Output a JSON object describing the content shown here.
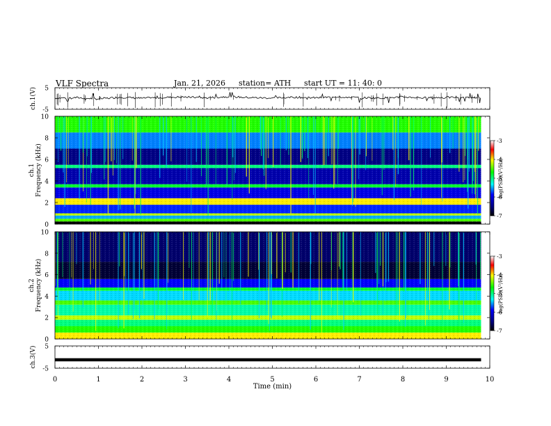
{
  "header": {
    "title": "VLF  Spectra",
    "date": "Jan. 21, 2026",
    "station": "station= ATH",
    "start": "start  UT  =   11: 40: 0"
  },
  "colors": {
    "spectrogram_low": "#000080",
    "spectrogram_mid": "#00ff00",
    "spectrogram_high": "#ff0000",
    "trace": "#000000"
  },
  "chart_data": [
    {
      "type": "line",
      "name": "ch1-waveform",
      "ylabel": "ch.1(V)",
      "ylim": [
        -5,
        5
      ],
      "yticks": [
        "5",
        "-5"
      ],
      "x": [
        0,
        0.5,
        1,
        1.5,
        2,
        2.5,
        3,
        3.5,
        4,
        4.5,
        5,
        5.5,
        6,
        6.5,
        7,
        7.5,
        8,
        8.5,
        9,
        9.5,
        9.8
      ],
      "y": [
        0.2,
        0.4,
        -0.2,
        0.6,
        0.1,
        0.5,
        0.7,
        0.3,
        0.9,
        0.4,
        0.2,
        0.6,
        0.3,
        0.8,
        0.4,
        0.2,
        0.7,
        0.3,
        0.5,
        0.6,
        0.3
      ]
    },
    {
      "type": "heatmap",
      "name": "ch1-spectrogram",
      "ylabel": "ch.1 Frequency  (kHz)",
      "ylim": [
        0,
        10
      ],
      "yticks": [
        "0",
        "2",
        "4",
        "6",
        "8",
        "10"
      ],
      "xlim": [
        0,
        10
      ],
      "data_extent_min": 9.8,
      "colorbar_label": "log(PSD)(V²/Hz)",
      "colorbar_ticks": [
        "-3",
        "-4",
        "-5",
        "-6",
        "-7"
      ],
      "bands_khz": [
        {
          "from": 0.0,
          "to": 0.25,
          "level": -7.0
        },
        {
          "from": 0.25,
          "to": 0.5,
          "level": -4.5
        },
        {
          "from": 0.5,
          "to": 0.8,
          "level": -5.5
        },
        {
          "from": 0.8,
          "to": 1.0,
          "level": -4.2
        },
        {
          "from": 1.0,
          "to": 1.8,
          "level": -5.8
        },
        {
          "from": 1.8,
          "to": 2.4,
          "level": -4.0
        },
        {
          "from": 2.4,
          "to": 3.4,
          "level": -6.0
        },
        {
          "from": 3.4,
          "to": 3.7,
          "level": -4.8
        },
        {
          "from": 3.7,
          "to": 5.2,
          "level": -6.3
        },
        {
          "from": 5.2,
          "to": 5.5,
          "level": -5.0
        },
        {
          "from": 5.5,
          "to": 7.0,
          "level": -6.5
        },
        {
          "from": 7.0,
          "to": 8.5,
          "level": -5.6
        },
        {
          "from": 8.5,
          "to": 10.0,
          "level": -4.6
        }
      ]
    },
    {
      "type": "heatmap",
      "name": "ch2-spectrogram",
      "ylabel": "ch.2 Frequency  (kHz)",
      "ylim": [
        0,
        10
      ],
      "yticks": [
        "0",
        "2",
        "4",
        "6",
        "8",
        "10"
      ],
      "xlim": [
        0,
        10
      ],
      "data_extent_min": 9.8,
      "colorbar_label": "log(PSD)(V²/Hz)",
      "colorbar_ticks": [
        "-3",
        "-4",
        "-5",
        "-6",
        "-7"
      ],
      "bands_khz": [
        {
          "from": 0.0,
          "to": 0.6,
          "level": -4.0
        },
        {
          "from": 0.6,
          "to": 1.2,
          "level": -4.6
        },
        {
          "from": 1.2,
          "to": 1.8,
          "level": -5.0
        },
        {
          "from": 1.8,
          "to": 2.2,
          "level": -4.2
        },
        {
          "from": 2.2,
          "to": 3.2,
          "level": -5.1
        },
        {
          "from": 3.2,
          "to": 3.6,
          "level": -4.5
        },
        {
          "from": 3.6,
          "to": 4.5,
          "level": -5.4
        },
        {
          "from": 4.5,
          "to": 4.8,
          "level": -4.8
        },
        {
          "from": 4.8,
          "to": 5.6,
          "level": -5.9
        },
        {
          "from": 5.6,
          "to": 7.2,
          "level": -6.8
        },
        {
          "from": 7.2,
          "to": 10.0,
          "level": -6.6
        }
      ]
    },
    {
      "type": "line",
      "name": "ch3-waveform",
      "ylabel": "ch.3(V)",
      "ylim": [
        -5,
        5
      ],
      "yticks": [
        "5",
        "-5"
      ],
      "xlabel": "Time  (min)",
      "xlim": [
        0,
        10
      ],
      "xticks": [
        "0",
        "1",
        "2",
        "3",
        "4",
        "5",
        "6",
        "7",
        "8",
        "9",
        "10"
      ],
      "x": [
        0,
        9.8
      ],
      "y": [
        -1.2,
        -1.2
      ]
    }
  ]
}
